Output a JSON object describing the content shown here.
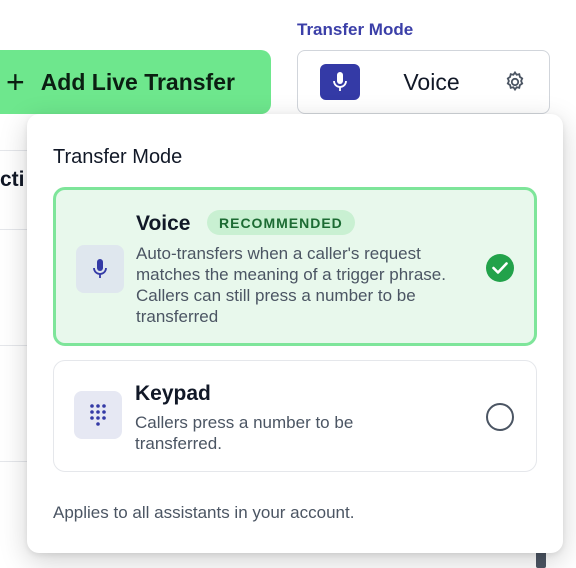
{
  "background": {
    "column_header": "cti"
  },
  "toolbar": {
    "add_button_plus": "+",
    "add_button_label": "Add Live Transfer",
    "transfer_mode_heading": "Transfer Mode",
    "mode_selected": "Voice",
    "icons": {
      "mode": "microphone-icon",
      "settings": "gear-icon"
    }
  },
  "panel": {
    "title": "Transfer Mode",
    "options": [
      {
        "name": "Voice",
        "badge": "RECOMMENDED",
        "description": "Auto-transfers when a caller's request matches the meaning of a trigger phrase. Callers can still press a number to be transferred",
        "selected": true,
        "icon": "microphone-icon"
      },
      {
        "name": "Keypad",
        "description": "Callers press a number to be transferred.",
        "selected": false,
        "icon": "keypad-icon"
      }
    ],
    "footer": "Applies to all assistants in your account."
  },
  "colors": {
    "accent_green": "#6ee78d",
    "selected_border": "#7ee59a",
    "selected_bg": "#e8f8ec",
    "check_green": "#22a24a",
    "indigo": "#343aa6",
    "heading_indigo": "#3b3fa8"
  }
}
